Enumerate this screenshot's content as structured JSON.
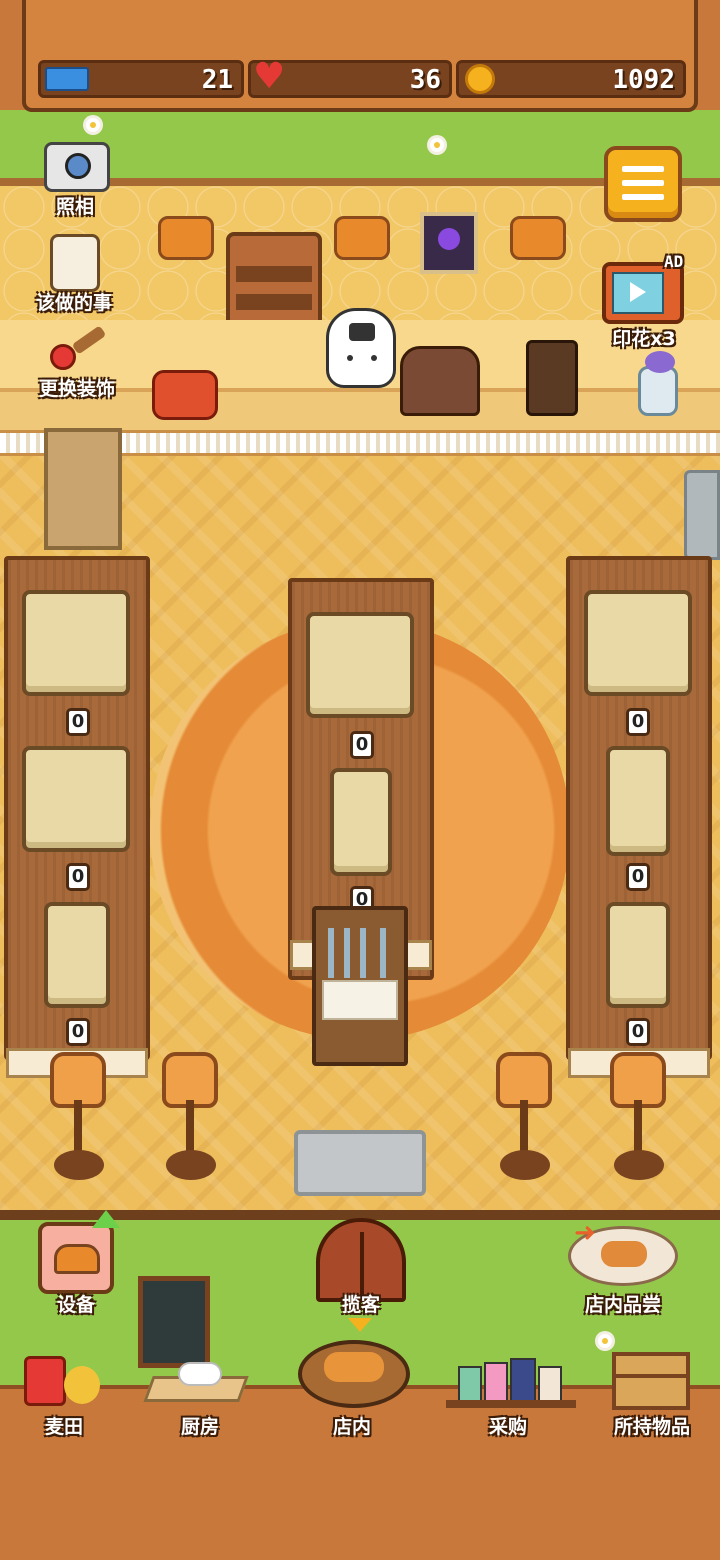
{
  "stats": {
    "tickets": "21",
    "hearts": "36",
    "coins": "1092"
  },
  "left_actions": {
    "camera": "照相",
    "todo": "该做的事",
    "decor": "更换装饰"
  },
  "right_actions": {
    "stamps": "印花x3",
    "tv_badge": "AD"
  },
  "seats": {
    "left": [
      "0",
      "0",
      "0"
    ],
    "middle": [
      "0",
      "0"
    ],
    "right": [
      "0",
      "0",
      "0"
    ]
  },
  "lower_actions": {
    "equipment": "设备",
    "solicit": "揽客",
    "tasting": "店内品尝"
  },
  "nav": [
    "麦田",
    "厨房",
    "店内",
    "采购",
    "所持物品"
  ],
  "colors": {
    "wood": "#c8783a",
    "grass": "#93c84a",
    "wall": "#f2c766",
    "floor": "#eebd5c",
    "accent": "#f6b21e"
  }
}
